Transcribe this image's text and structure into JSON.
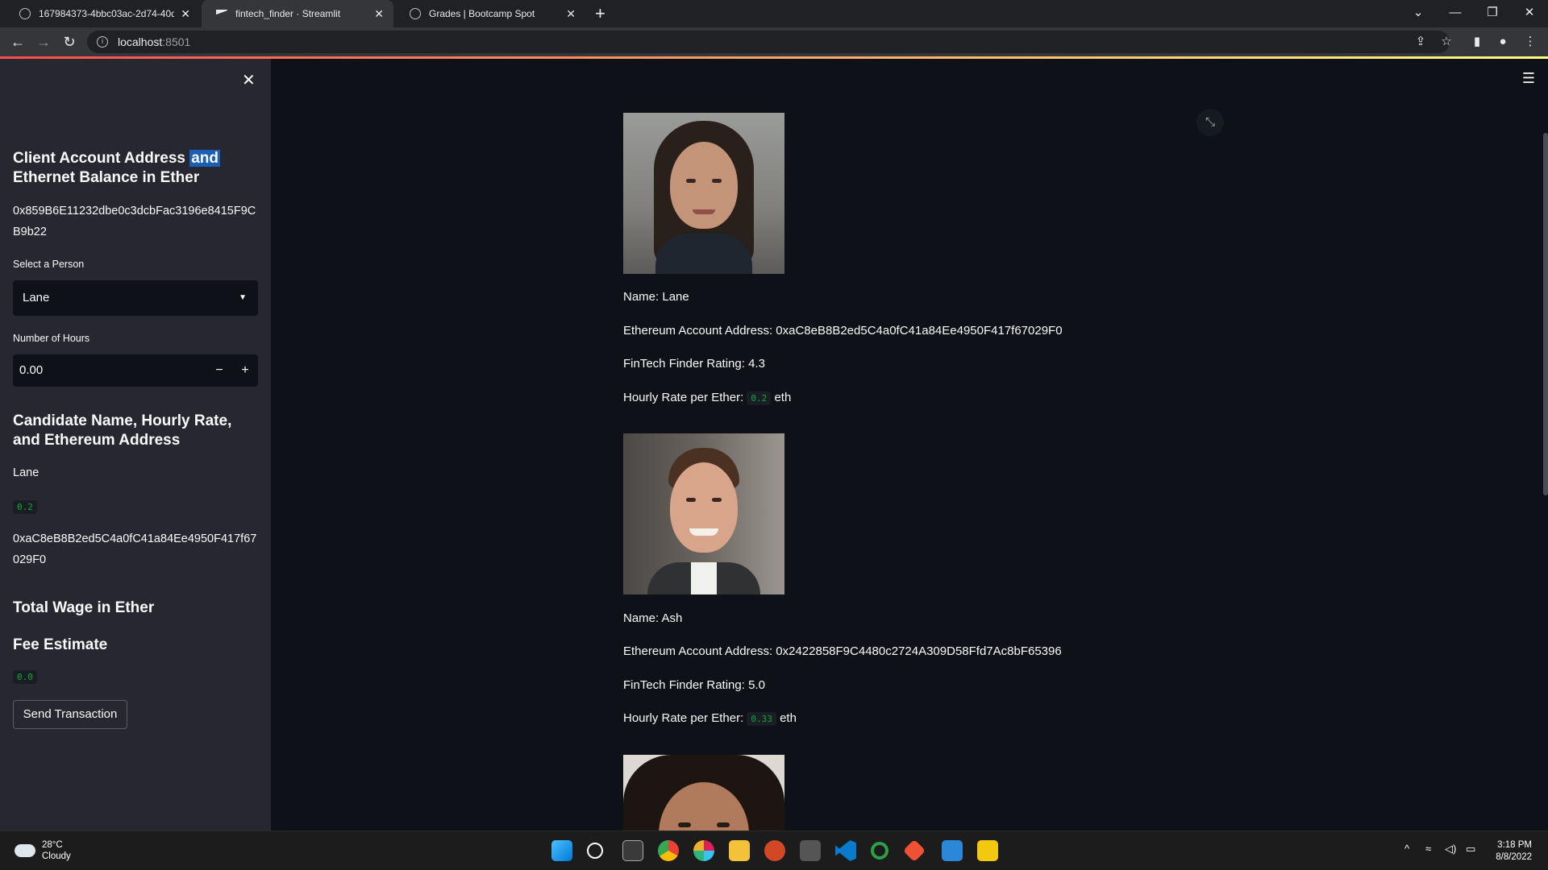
{
  "browser": {
    "tabs": [
      {
        "title": "167984373-4bbc03ac-2d74-40d"
      },
      {
        "title": "fintech_finder · Streamlit"
      },
      {
        "title": "Grades | Bootcamp Spot"
      }
    ],
    "url_host": "localhost",
    "url_port": ":8501"
  },
  "sidebar": {
    "heading1_pre": "Client Account Address ",
    "heading1_hl": "and",
    "heading1_post": "Ethernet Balance in Ether",
    "client_address": "0x859B6E11232dbe0c3dcbFac3196e8415F9CB9b22",
    "select_label": "Select a Person",
    "select_value": "Lane",
    "hours_label": "Number of Hours",
    "hours_value": "0.00",
    "heading2": "Candidate Name, Hourly Rate, and Ethereum Address",
    "candidate_name": "Lane",
    "candidate_rate": "0.2",
    "candidate_address": "0xaC8eB8B2ed5C4a0fC41a84Ee4950F417f67029F0",
    "heading3": "Total Wage in Ether",
    "heading4": "Fee Estimate",
    "fee_value": "0.0",
    "send_button": "Send Transaction"
  },
  "candidates": [
    {
      "name_line": "Name: Lane",
      "address_line": "Ethereum Account Address: 0xaC8eB8B2ed5C4a0fC41a84Ee4950F417f67029F0",
      "rating_line": "FinTech Finder Rating: 4.3",
      "rate_prefix": "Hourly Rate per Ether:",
      "rate": "0.2",
      "rate_suffix": "eth"
    },
    {
      "name_line": "Name: Ash",
      "address_line": "Ethereum Account Address: 0x2422858F9C4480c2724A309D58Ffd7Ac8bF65396",
      "rating_line": "FinTech Finder Rating: 5.0",
      "rate_prefix": "Hourly Rate per Ether:",
      "rate": "0.33",
      "rate_suffix": "eth"
    }
  ],
  "taskbar": {
    "temp": "28°C",
    "weather": "Cloudy",
    "time": "3:18 PM",
    "date": "8/8/2022"
  },
  "icons": [
    "close-icon",
    "hamburger-menu-icon",
    "fullscreen-icon",
    "chevron-down-icon",
    "minus-icon",
    "plus-icon"
  ]
}
